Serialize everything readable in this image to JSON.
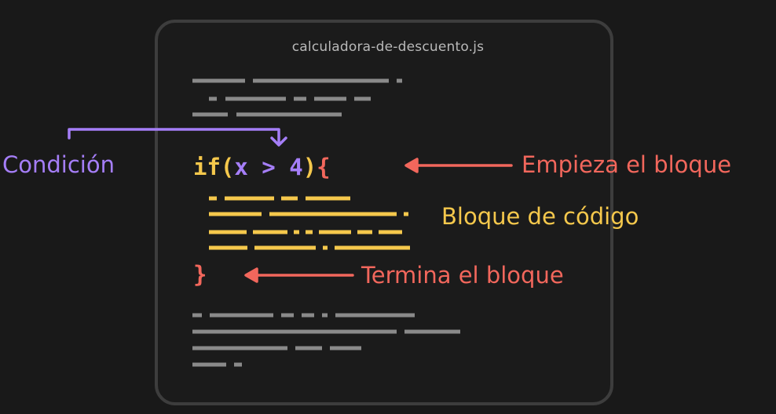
{
  "colors": {
    "background": "#191919",
    "window_border": "#3d3d3d",
    "filler_gray": "#8a8a8a",
    "keyword_yellow": "#f5c84c",
    "condition_purple": "#a57ef8",
    "brace_red": "#f2675c",
    "label_red": "#f2675c",
    "label_yellow": "#f5c84c",
    "label_purple": "#a57ef8"
  },
  "window": {
    "filename": "calculadora-de-descuento.js"
  },
  "code": {
    "keyword": "if",
    "open_paren": "(",
    "condition": "x > 4",
    "close_paren": ")",
    "open_brace": "{",
    "close_brace": "}"
  },
  "labels": {
    "condition": "Condición",
    "block_start": "Empieza el bloque",
    "code_block": "Bloque de código",
    "block_end": "Termina el bloque"
  },
  "icons": {
    "condition_arrow": "arrow-down-icon",
    "start_arrow": "arrow-left-icon",
    "end_arrow": "arrow-left-icon"
  }
}
